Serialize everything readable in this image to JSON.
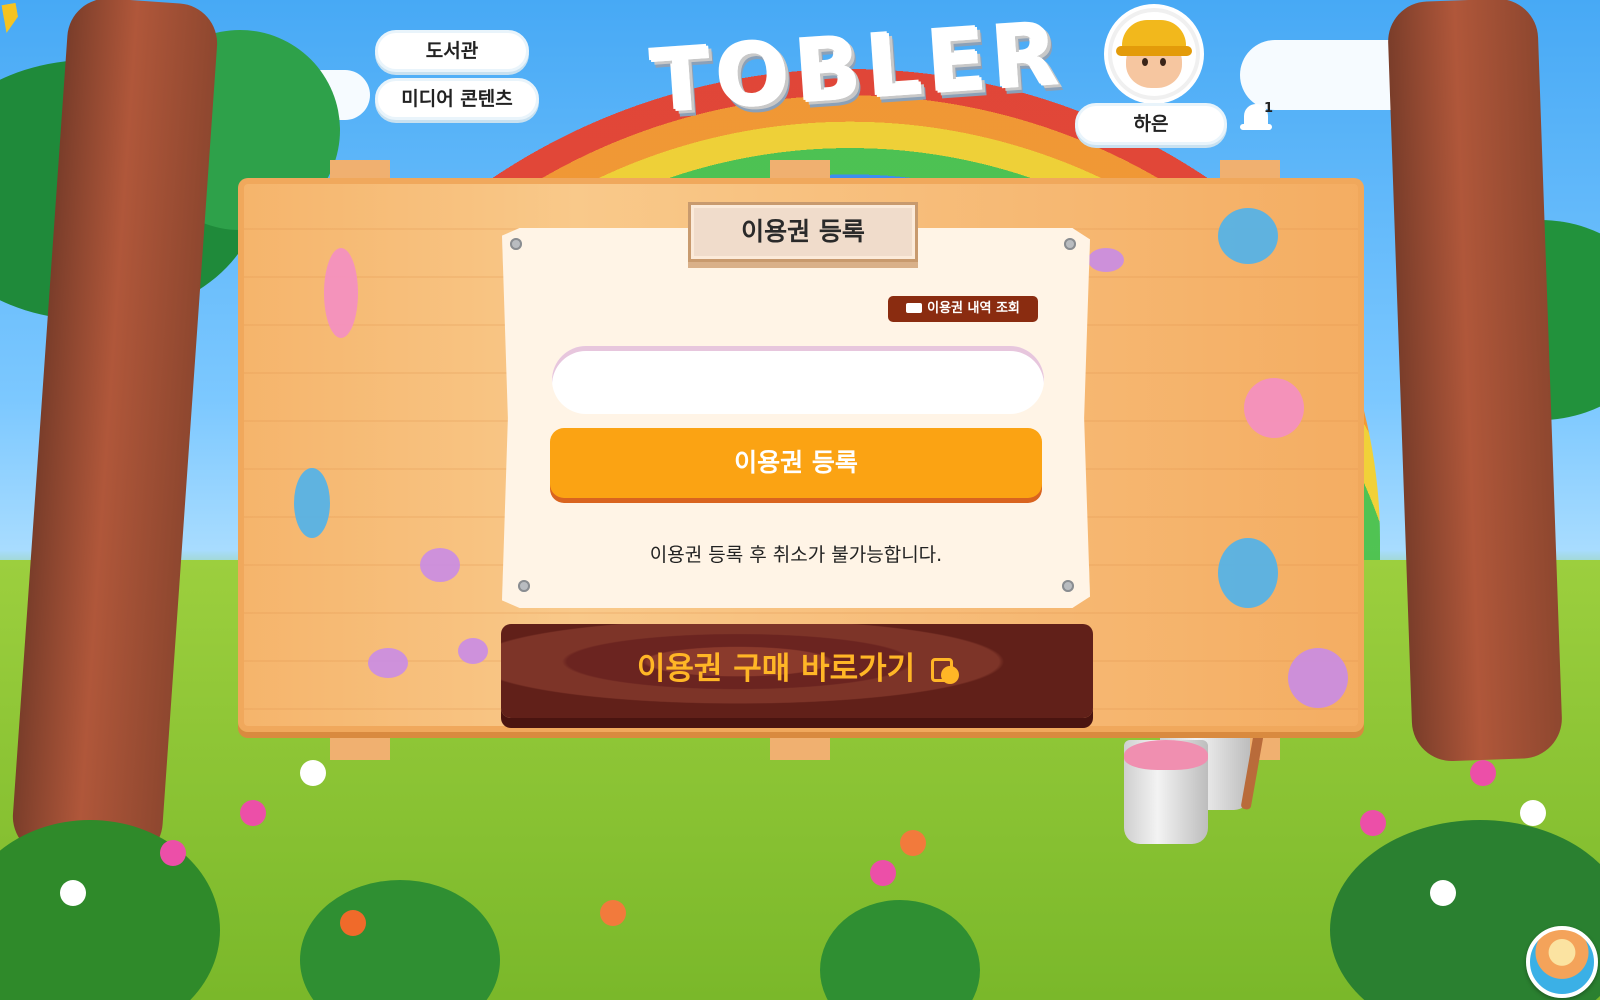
{
  "nav": {
    "library": "도서관",
    "media": "미디어 콘텐츠"
  },
  "logo": {
    "text": "TOBLER"
  },
  "user": {
    "name": "하은",
    "notification_count": "1"
  },
  "panel": {
    "title": "이용권 등록",
    "history_button": "이용권 내역 조회",
    "code_input_value": "",
    "register_button": "이용권 등록",
    "notice": "이용권 등록 후 취소가 불가능합니다."
  },
  "purchase": {
    "label": "이용권 구매 바로가기",
    "currency_symbol": "₩"
  },
  "colors": {
    "register_button": "#fba313",
    "history_button": "#8a2c10",
    "purchase_text": "#ffb626",
    "purchase_bg": "#6b2420"
  },
  "icons": [
    "cursor-arrow-icon",
    "bell-icon",
    "ticket-icon",
    "shopping-bag-won-icon",
    "globe-island-icon"
  ]
}
